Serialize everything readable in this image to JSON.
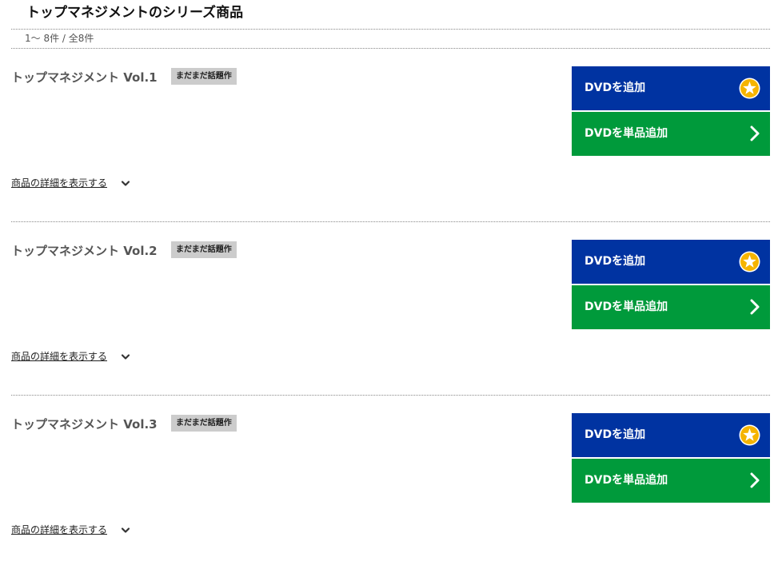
{
  "header": {
    "title": "トップマネジメントのシリーズ商品",
    "count": "1～ 8件 / 全8件"
  },
  "colors": {
    "add_dvd_button": "#0033a1",
    "add_single_button": "#009a3b",
    "badge": "#cccccc",
    "star": "#f5b400"
  },
  "icons": {
    "add_dvd": "star-icon",
    "add_single": "chevron-right-icon",
    "detail_toggle": "chevron-down-icon"
  },
  "items": [
    {
      "title": "トップマネジメント Vol.1",
      "badge": "まだまだ話題作",
      "add_dvd_label": "DVDを追加",
      "add_single_label": "DVDを単品追加",
      "detail_label": "商品の詳細を表示する"
    },
    {
      "title": "トップマネジメント Vol.2",
      "badge": "まだまだ話題作",
      "add_dvd_label": "DVDを追加",
      "add_single_label": "DVDを単品追加",
      "detail_label": "商品の詳細を表示する"
    },
    {
      "title": "トップマネジメント Vol.3",
      "badge": "まだまだ話題作",
      "add_dvd_label": "DVDを追加",
      "add_single_label": "DVDを単品追加",
      "detail_label": "商品の詳細を表示する"
    }
  ]
}
